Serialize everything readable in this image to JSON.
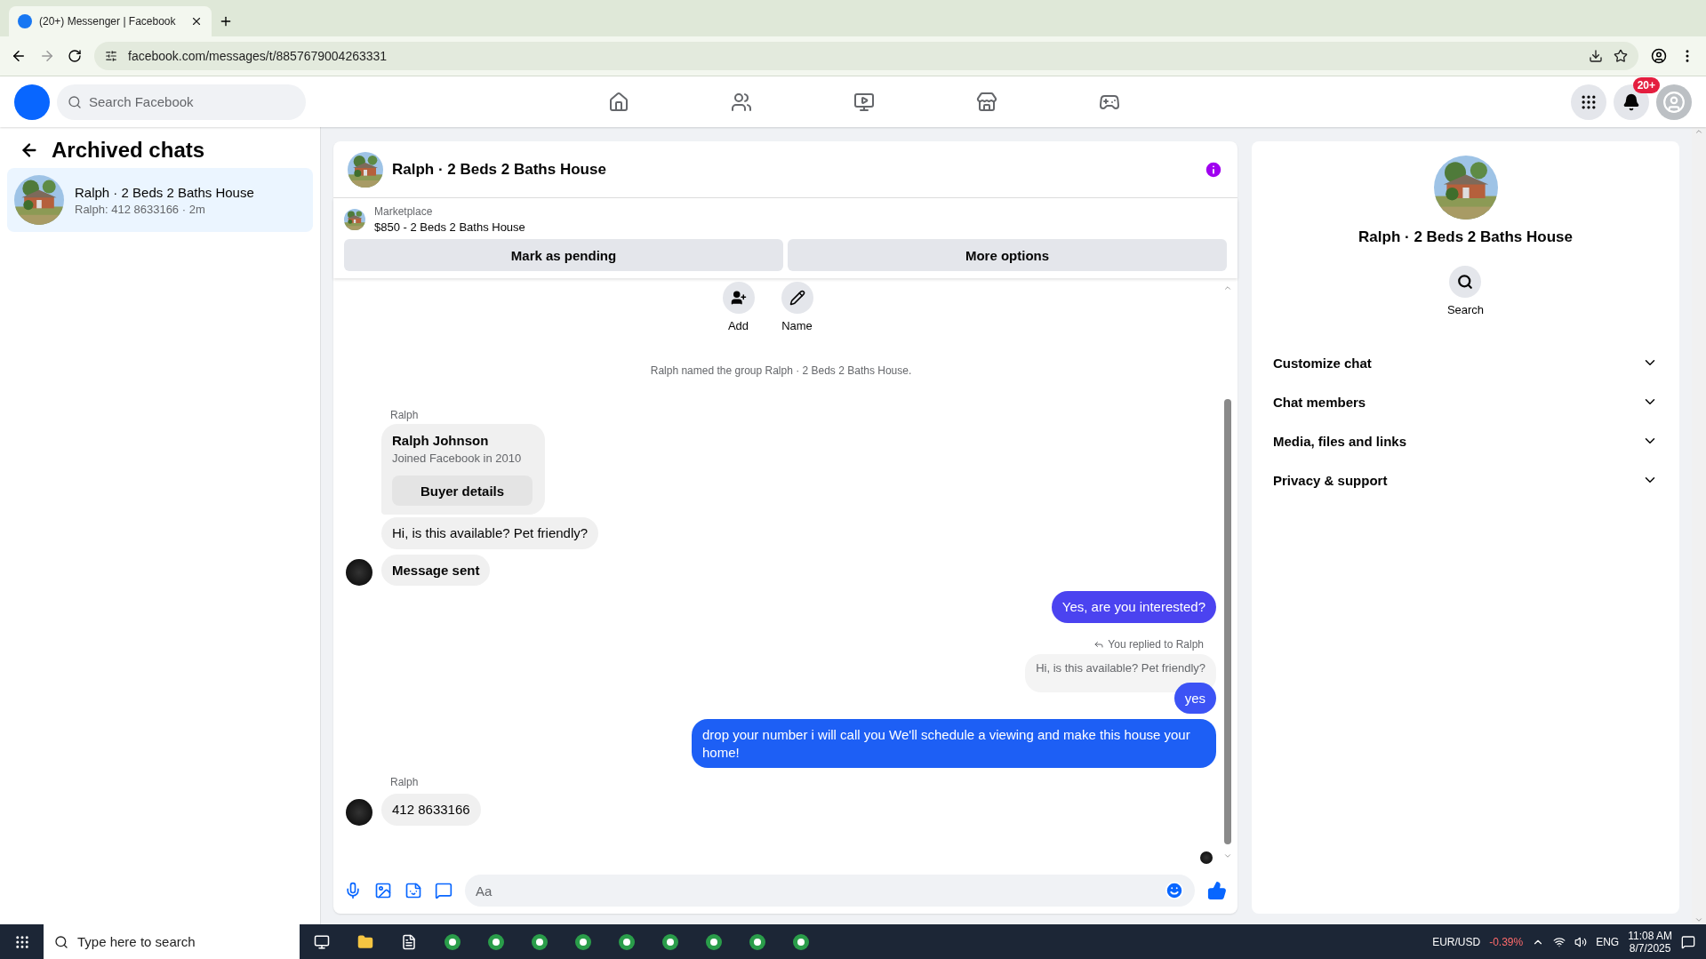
{
  "browser": {
    "tab_title": "(20+) Messenger | Facebook",
    "url": "facebook.com/messages/t/8857679004263331"
  },
  "header": {
    "search_placeholder": "Search Facebook",
    "notification_badge": "20+"
  },
  "sidebar": {
    "title": "Archived chats",
    "chats": [
      {
        "name": "Ralph · 2 Beds 2 Baths House",
        "preview": "Ralph: 412 8633166 · 2m",
        "selected": true
      }
    ]
  },
  "chat": {
    "title": "Ralph · 2 Beds 2 Baths House",
    "listing": {
      "source": "Marketplace",
      "title": "$850 - 2 Beds 2 Baths House"
    },
    "listing_buttons": [
      "Mark as pending",
      "More options"
    ],
    "actions": [
      {
        "kind": "add",
        "label": "Add"
      },
      {
        "kind": "name",
        "label": "Name"
      }
    ],
    "messages": [
      {
        "kind": "system",
        "text": "Ralph named the group Ralph · 2 Beds 2 Baths House."
      },
      {
        "kind": "sender",
        "text": "Ralph"
      },
      {
        "kind": "card",
        "name": "Ralph Johnson",
        "detail": "Joined Facebook in 2010",
        "button": "Buyer details"
      },
      {
        "kind": "incoming",
        "text": "Hi, is this available? Pet friendly?",
        "avatar": false
      },
      {
        "kind": "incoming",
        "text": "Message sent",
        "avatar": true,
        "bold": true
      },
      {
        "kind": "outgoing",
        "text": "Yes, are you interested?",
        "color": "#4b43f0"
      },
      {
        "kind": "reply_note",
        "text": "You replied to Ralph"
      },
      {
        "kind": "quoted",
        "text": "Hi, is this available? Pet friendly?"
      },
      {
        "kind": "outgoing",
        "text": "yes",
        "color": "#3c53f5"
      },
      {
        "kind": "outgoing",
        "text": "drop your number i will call you We'll schedule a viewing and make this house your home!",
        "color": "#1d5ff5"
      },
      {
        "kind": "sender",
        "text": "Ralph"
      },
      {
        "kind": "incoming",
        "text": "412 8633166",
        "avatar": true,
        "bold": false
      }
    ],
    "composer": {
      "placeholder": "Aa"
    }
  },
  "details": {
    "title": "Ralph · 2 Beds 2 Baths House",
    "action": "Search",
    "sections": [
      {
        "label": "Customize chat",
        "expanded": false
      },
      {
        "label": "Chat members",
        "expanded": false
      },
      {
        "label": "Media, files and links",
        "expanded": false
      },
      {
        "label": "Privacy & support",
        "expanded": false
      }
    ]
  },
  "taskbar": {
    "search_placeholder": "Type here to search",
    "ticker": {
      "symbol": "EUR/USD",
      "change": "-0.39%"
    },
    "language": "ENG",
    "time": "11:08 AM",
    "date": "8/7/2025"
  }
}
